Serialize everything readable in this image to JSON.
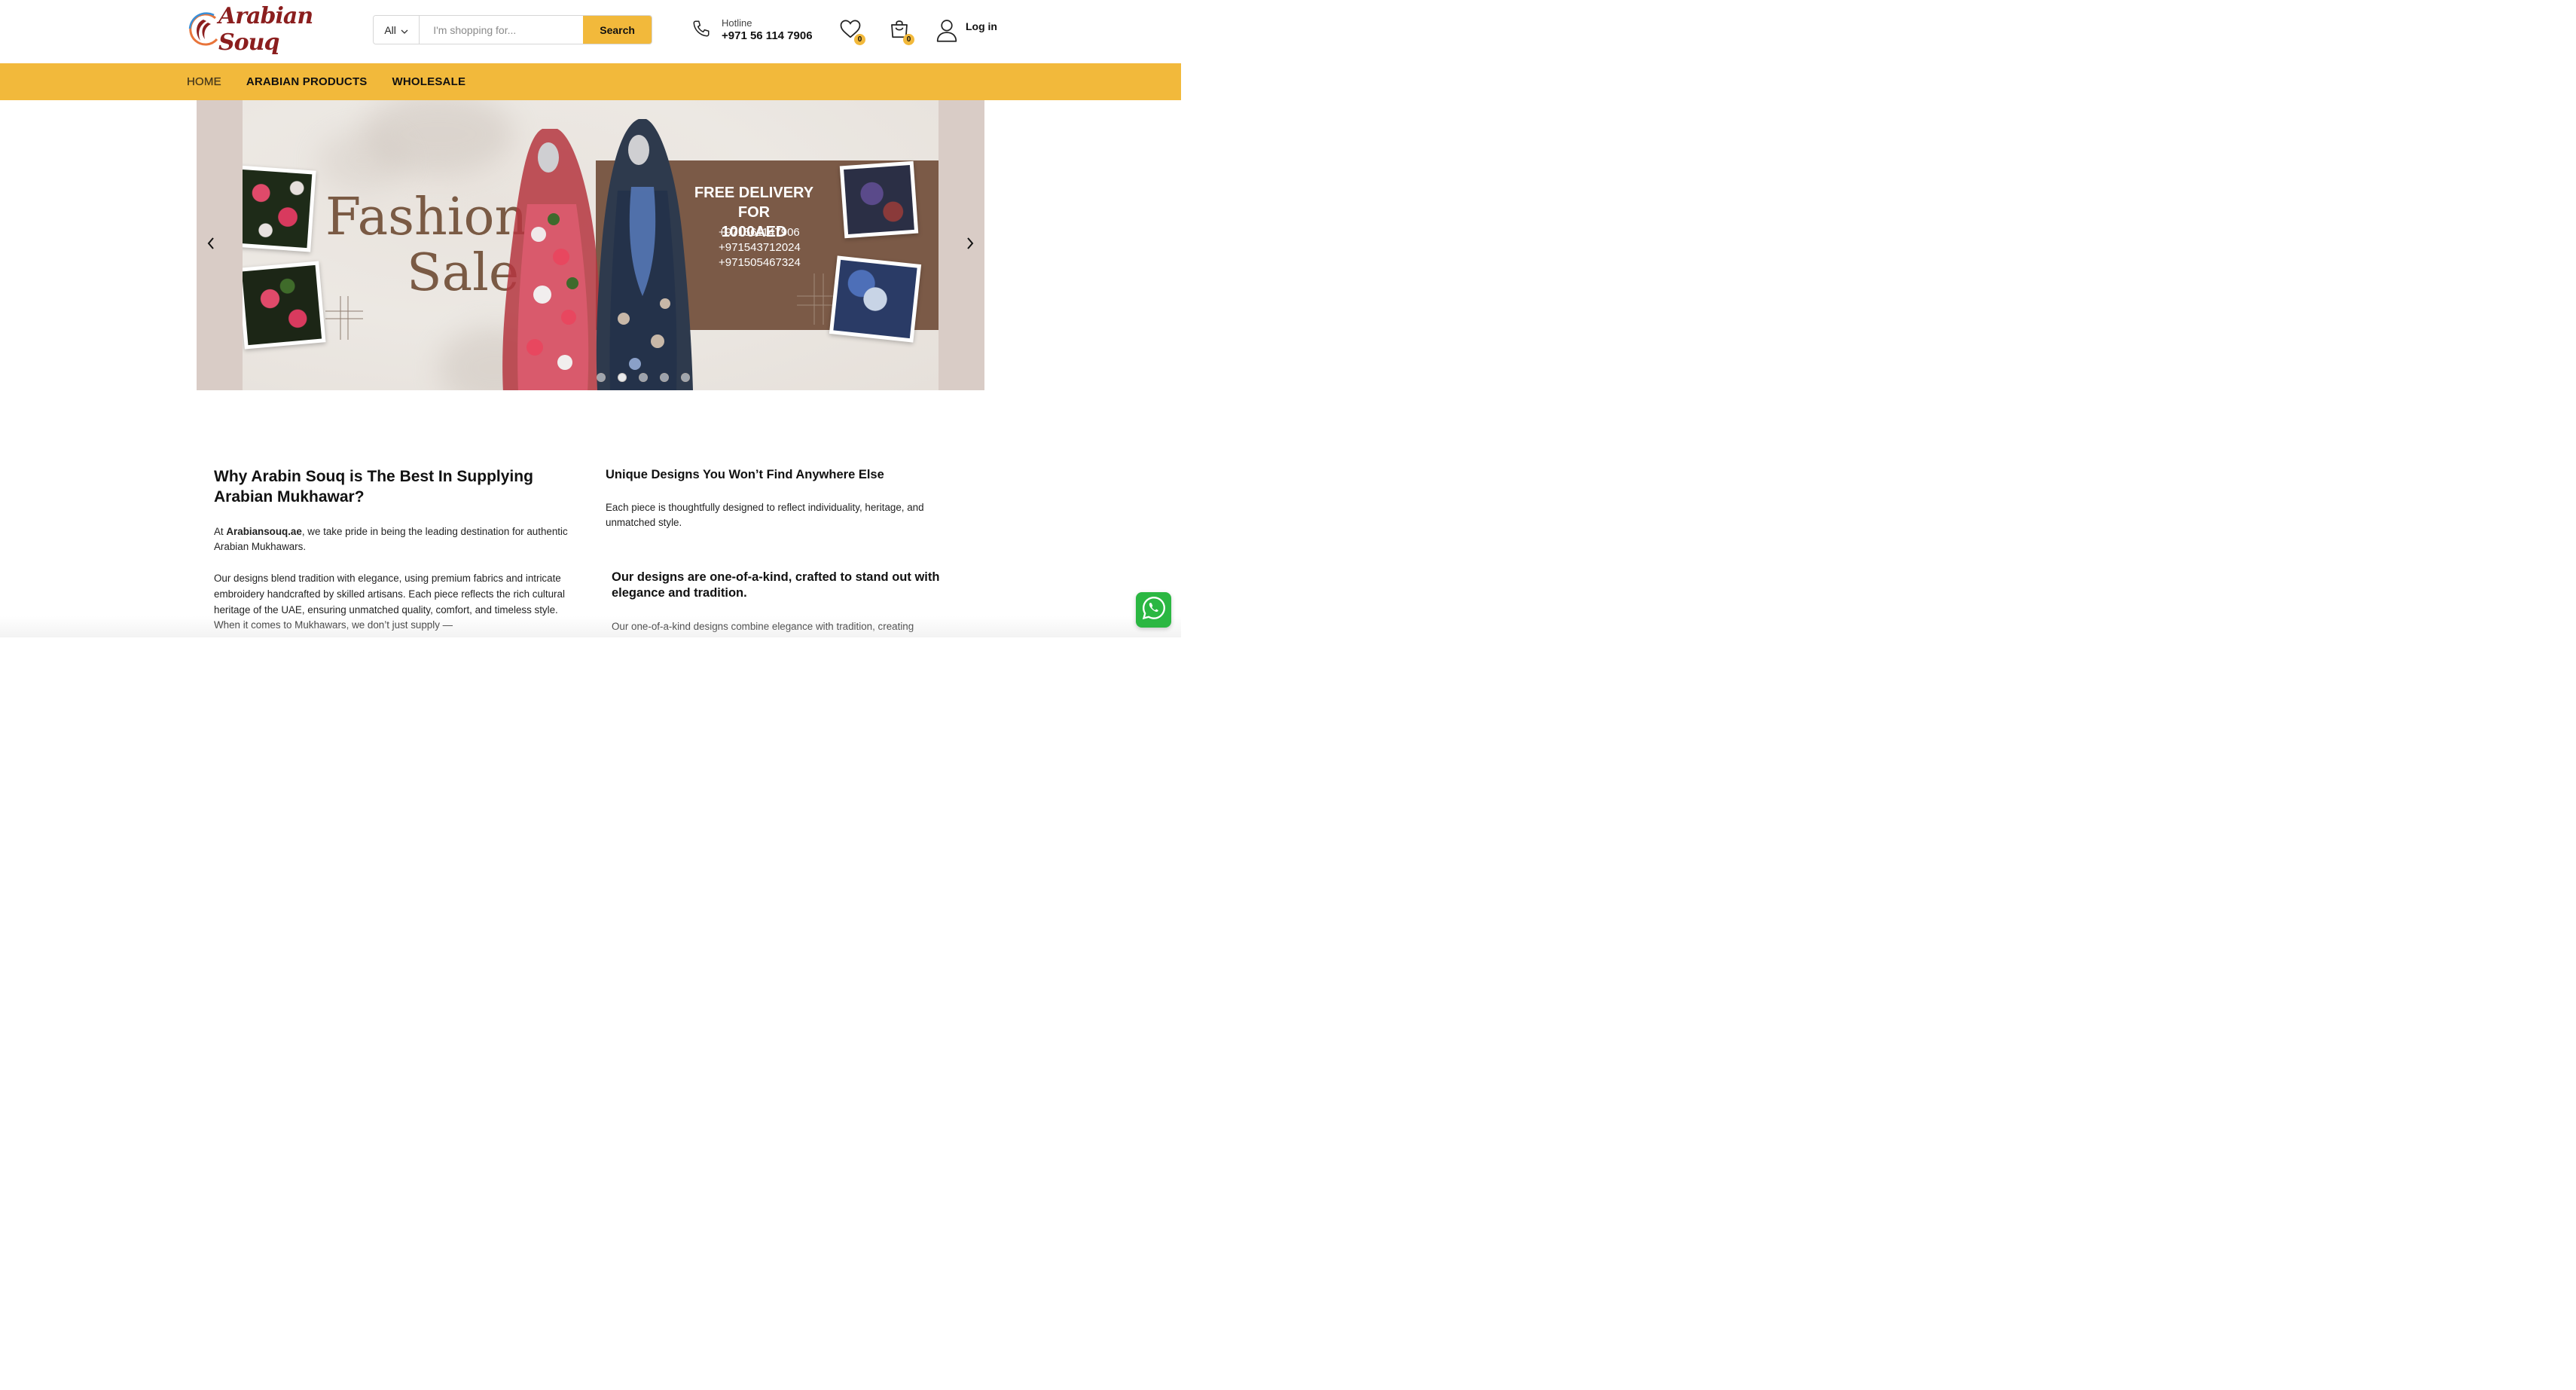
{
  "header": {
    "logo_text": "Arabian Souq",
    "search": {
      "category": "All",
      "placeholder": "I'm shopping for...",
      "button": "Search"
    },
    "hotline": {
      "label": "Hotline",
      "number": "+971 56 114 7906"
    },
    "wishlist_count": "0",
    "cart_count": "0",
    "login_label": "Log in"
  },
  "nav": {
    "items": [
      "HOME",
      "ARABIAN PRODUCTS",
      "WHOLESALE"
    ]
  },
  "hero": {
    "title_line1": "Fashion",
    "title_line2": "Sale",
    "promo_line1": "FREE DELIVERY FOR",
    "promo_line2": "1000AED",
    "phones": [
      "+971561147906",
      "+971543712024",
      "+971505467324"
    ],
    "slide_count": 5,
    "active_slide": 1
  },
  "content": {
    "left_heading": "Why Arabin Souq is The Best In Supplying Arabian Mukhawar?",
    "left_p1_prefix": "At ",
    "left_p1_brand": "Arabiansouq.ae",
    "left_p1_suffix": ", we take pride in being the leading destination for authentic Arabian Mukhawars.",
    "left_p2": "Our designs blend tradition with elegance, using premium fabrics and intricate embroidery handcrafted by skilled artisans. Each piece reflects the rich cultural heritage of the UAE, ensuring unmatched quality, comfort, and timeless style. When it comes to Mukhawars, we don’t just supply —",
    "right_heading": "Unique Designs You Won’t Find Anywhere Else",
    "right_p1": "Each piece is thoughtfully designed to reflect individuality, heritage, and unmatched style.",
    "right_subheading": "Our designs are one-of-a-kind, crafted to stand out with elegance and tradition.",
    "right_p2": "Our one-of-a-kind designs combine elegance with tradition, creating"
  },
  "colors": {
    "accent": "#f2b93b",
    "brand": "#8b1e1e",
    "promo_bg": "#7b5a47",
    "whatsapp": "#2bb742"
  }
}
